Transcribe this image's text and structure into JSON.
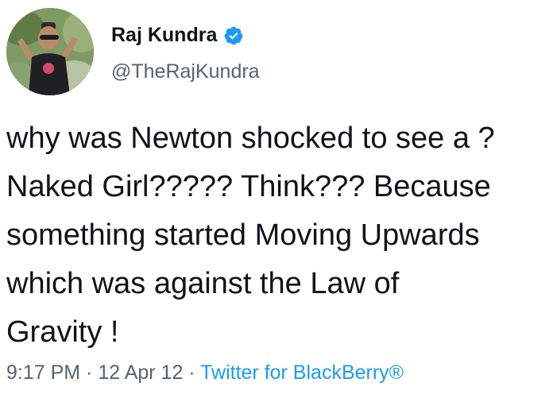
{
  "user": {
    "display_name": "Raj Kundra",
    "handle": "@TheRajKundra",
    "verified_icon": "verified-badge-icon",
    "verified_color": "#1d9bf0"
  },
  "tweet": {
    "lines": [
      "why was Newton shocked to see a ?",
      "Naked Girl????? Think??? Because",
      "something started Moving Upwards",
      "which was against the Law of",
      "Gravity !"
    ]
  },
  "meta": {
    "time": "9:17 PM",
    "separator": " · ",
    "date": "12 Apr 12",
    "source": "Twitter for BlackBerry®",
    "source_color": "#1d9bf0"
  }
}
